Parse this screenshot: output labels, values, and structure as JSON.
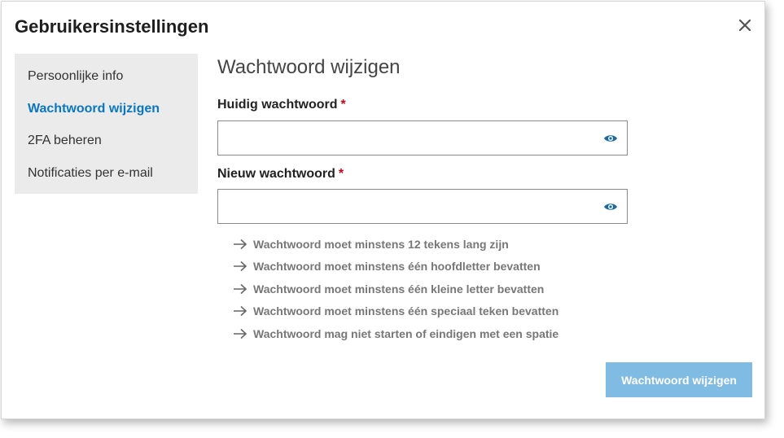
{
  "dialog": {
    "title": "Gebruikersinstellingen",
    "close_icon": "close-icon"
  },
  "sidebar": {
    "items": [
      {
        "label": "Persoonlijke info",
        "active": false
      },
      {
        "label": "Wachtwoord wijzigen",
        "active": true
      },
      {
        "label": "2FA beheren",
        "active": false
      },
      {
        "label": "Notificaties per e-mail",
        "active": false
      }
    ]
  },
  "main": {
    "title": "Wachtwoord wijzigen",
    "current_password": {
      "label": "Huidig wachtwoord",
      "required_mark": "*",
      "value": "",
      "icon": "eye-icon"
    },
    "new_password": {
      "label": "Nieuw wachtwoord",
      "required_mark": "*",
      "value": "",
      "icon": "eye-icon"
    },
    "rules": [
      "Wachtwoord moet minstens 12 tekens lang zijn",
      "Wachtwoord moet minstens één hoofdletter bevatten",
      "Wachtwoord moet minstens één kleine letter bevatten",
      "Wachtwoord moet minstens één speciaal teken bevatten",
      "Wachtwoord mag niet starten of eindigen met een spatie"
    ],
    "submit_label": "Wachtwoord wijzigen"
  },
  "colors": {
    "accent": "#0a76c2",
    "required": "#d0021b",
    "button_disabled": "#7fbbe3",
    "sidebar_bg": "#ebebeb",
    "rule_text": "#777777"
  }
}
